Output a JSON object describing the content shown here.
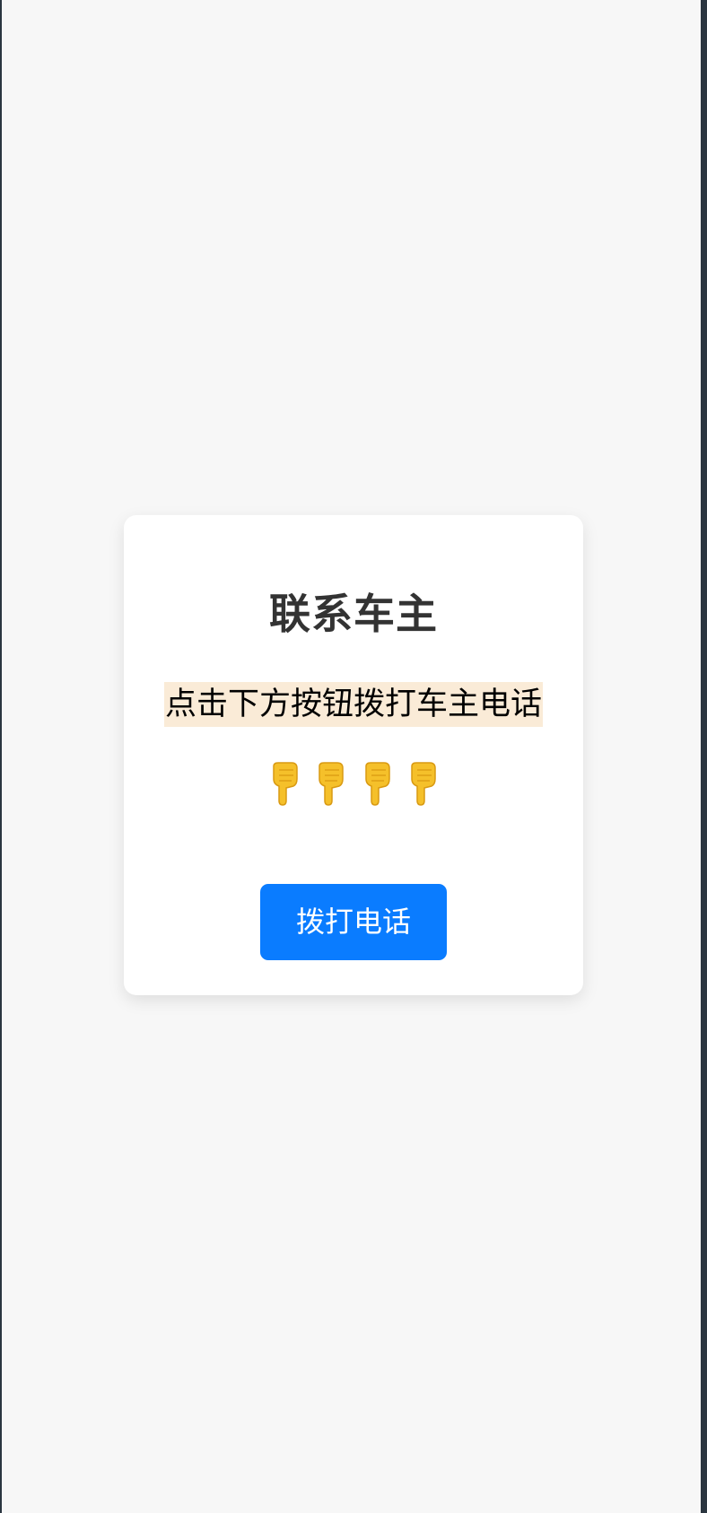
{
  "card": {
    "title": "联系车主",
    "subtitle": "点击下方按钮拨打车主电话",
    "pointers": [
      "hand-pointing-down-icon",
      "hand-pointing-down-icon",
      "hand-pointing-down-icon",
      "hand-pointing-down-icon"
    ],
    "call_button_label": "拨打电话"
  },
  "colors": {
    "page_background": "#f7f7f7",
    "card_background": "#ffffff",
    "title_text": "#333333",
    "subtitle_highlight": "#faebd7",
    "button_background": "#0a7cff",
    "button_text": "#ffffff",
    "pointer_yellow": "#f5c02a"
  }
}
